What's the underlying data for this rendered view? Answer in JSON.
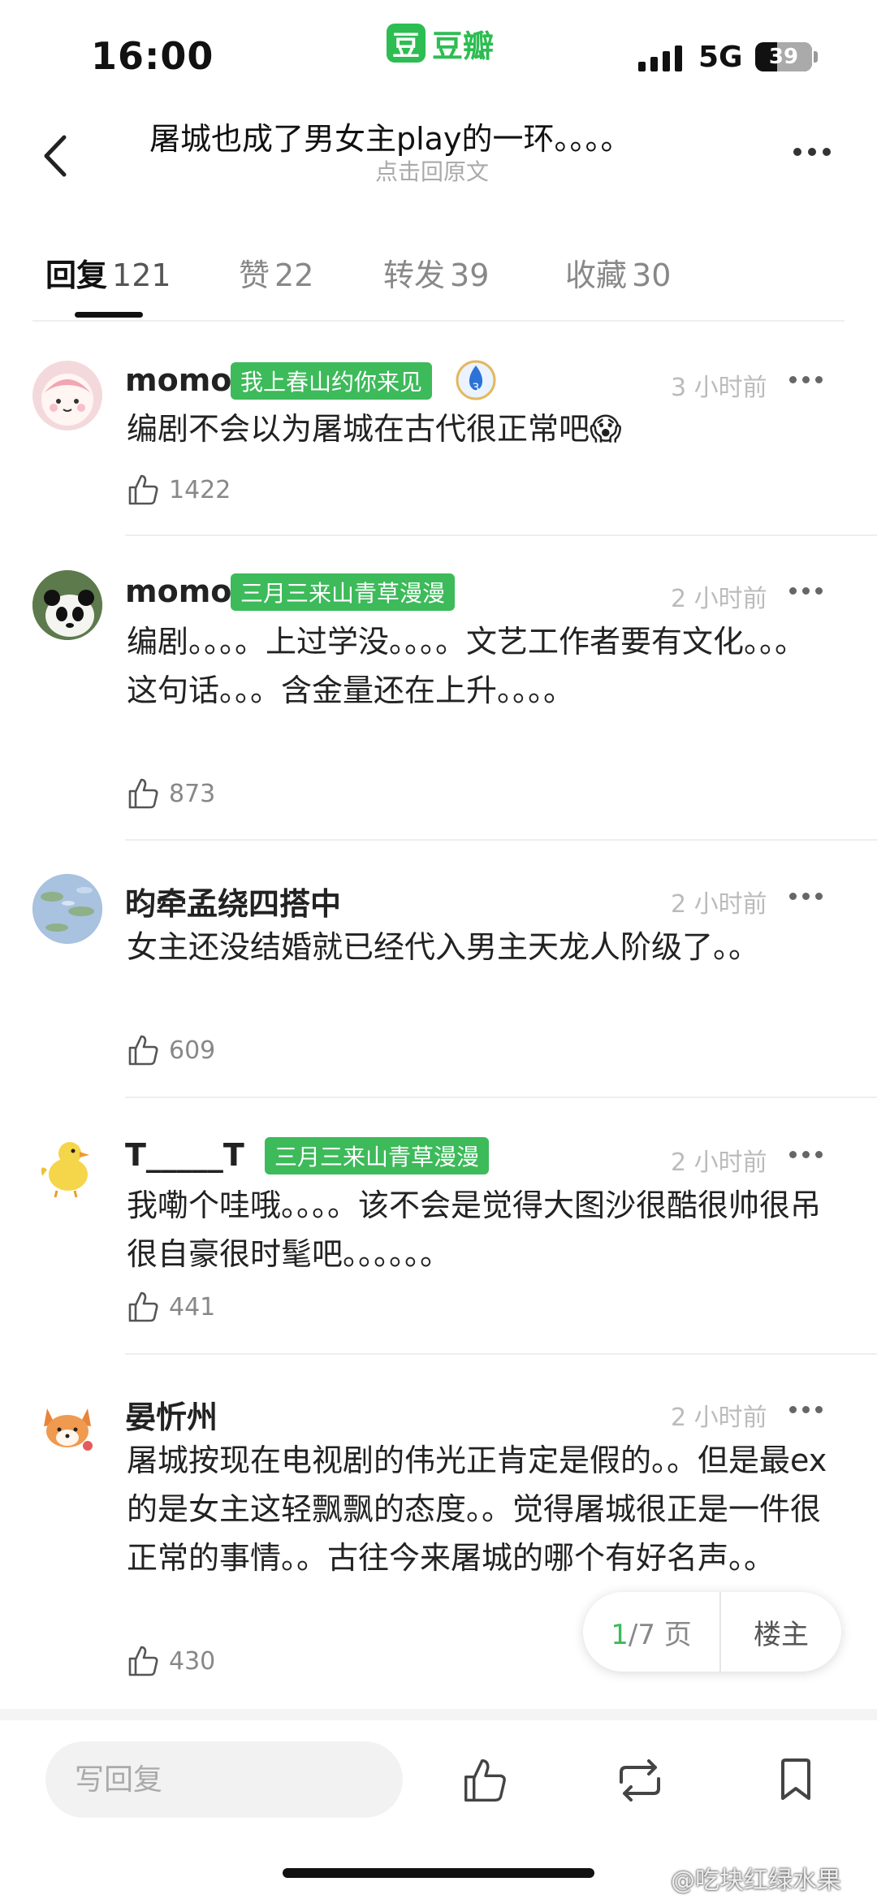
{
  "status_bar": {
    "time": "16:00",
    "network": "5G",
    "battery": "39",
    "battery_level": 0.39
  },
  "brand": {
    "logo_char": "豆",
    "name": "豆瓣"
  },
  "nav": {
    "title": "屠城也成了男女主play的一环。。。。",
    "subtitle": "点击回原文"
  },
  "tabs": [
    {
      "label": "回复",
      "count": "121",
      "active": true
    },
    {
      "label": "赞",
      "count": "22",
      "active": false
    },
    {
      "label": "转发",
      "count": "39",
      "active": false
    },
    {
      "label": "收藏",
      "count": "30",
      "active": false
    }
  ],
  "comments": [
    {
      "name": "momo",
      "badge": "我上春山约你来见",
      "level_badge": "3",
      "time": "3 小时前",
      "text": "编剧不会以为屠城在古代很正常吧😱",
      "likes": "1422",
      "avatar": "pink-character-avatar"
    },
    {
      "name": "momo",
      "badge": "三月三来山青草漫漫",
      "time": "2 小时前",
      "text": "编剧。。。。上过学没。。。。文艺工作者要有文化。。。这句话。。。含金量还在上升。。。。",
      "likes": "873",
      "avatar": "panda-avatar"
    },
    {
      "name": "昀牵孟绕四搭中",
      "time": "2 小时前",
      "text": "女主还没结婚就已经代入男主天龙人阶级了。。",
      "likes": "609",
      "avatar": "water-lily-avatar"
    },
    {
      "name": "T_____T",
      "badge": "三月三来山青草漫漫",
      "time": "2 小时前",
      "text": "我嘞个哇哦。。。。该不会是觉得大图沙很酷很帅很吊很自豪很时髦吧。。。。。。",
      "likes": "441",
      "avatar": "chick-avatar"
    },
    {
      "name": "晏忻州",
      "time": "2 小时前",
      "text": "屠城按现在电视剧的伟光正肯定是假的。。但是最ex的是女主这轻飘飘的态度。。觉得屠城很正是一件很正常的事情。。古往今来屠城的哪个有好名声。。",
      "likes": "430",
      "avatar": "fox-avatar"
    }
  ],
  "pager": {
    "current": "1",
    "total_label": "/7 页",
    "owner_label": "楼主"
  },
  "bottom_bar": {
    "reply_placeholder": "写回复"
  },
  "watermark": "@吃块红绿水果"
}
